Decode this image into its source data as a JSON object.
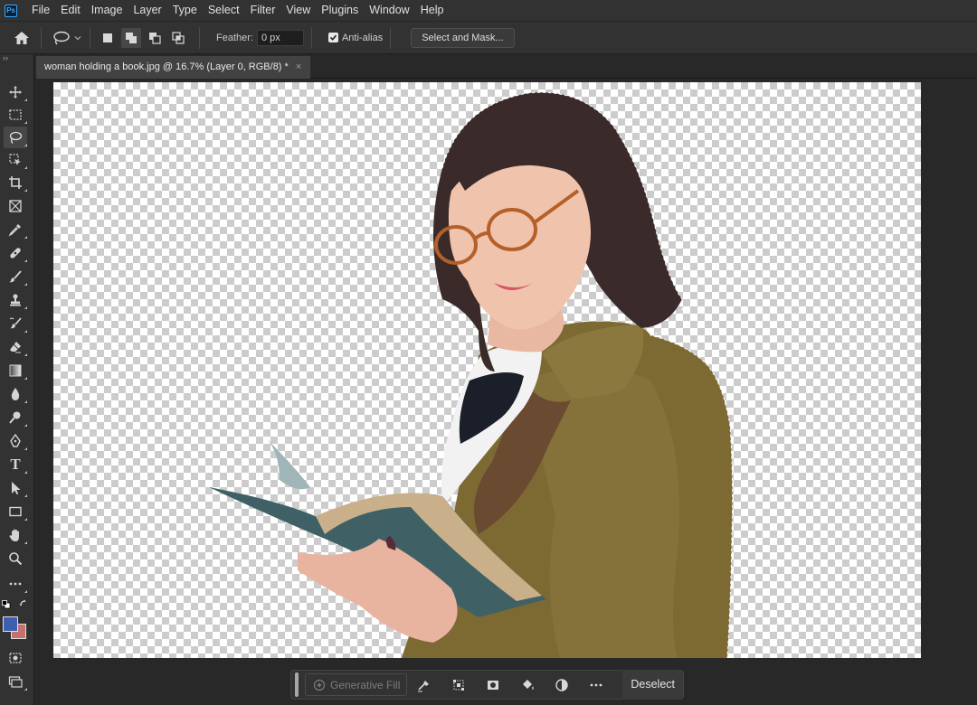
{
  "app": {
    "logo_text": "Ps"
  },
  "menu": [
    "File",
    "Edit",
    "Image",
    "Layer",
    "Type",
    "Select",
    "Filter",
    "View",
    "Plugins",
    "Window",
    "Help"
  ],
  "options_bar": {
    "feather_label": "Feather:",
    "feather_value": "0 px",
    "anti_alias_label": "Anti-alias",
    "anti_alias_checked": true,
    "select_and_mask": "Select and Mask..."
  },
  "document": {
    "tab_title": "woman holding a book.jpg @ 16.7% (Layer 0, RGB/8) *",
    "close": "×"
  },
  "toolbar": {
    "collapse": "››",
    "tools": [
      "move-tool",
      "rectangular-marquee-tool",
      "lasso-tool",
      "object-selection-tool",
      "crop-tool",
      "frame-tool",
      "eyedropper-tool",
      "healing-brush-tool",
      "brush-tool",
      "clone-stamp-tool",
      "history-brush-tool",
      "eraser-tool",
      "gradient-tool",
      "blur-tool",
      "dodge-tool",
      "pen-tool",
      "type-tool",
      "path-selection-tool",
      "rectangle-tool",
      "hand-tool",
      "zoom-tool",
      "edit-toolbar"
    ],
    "active_tool": "lasso-tool",
    "type_tool_glyph": "T",
    "foreground_color": "#3e5fb0",
    "background_color": "#c7716c"
  },
  "taskbar": {
    "generative_fill": "Generative Fill",
    "deselect": "Deselect",
    "icons": [
      "modify-selection-icon",
      "transform-selection-icon",
      "mask-icon",
      "fill-icon",
      "invert-selection-icon",
      "more-options-icon"
    ]
  },
  "colors": {
    "accent": "#31a8ff",
    "coat": "#7d6a33",
    "book": "#3f6165"
  }
}
